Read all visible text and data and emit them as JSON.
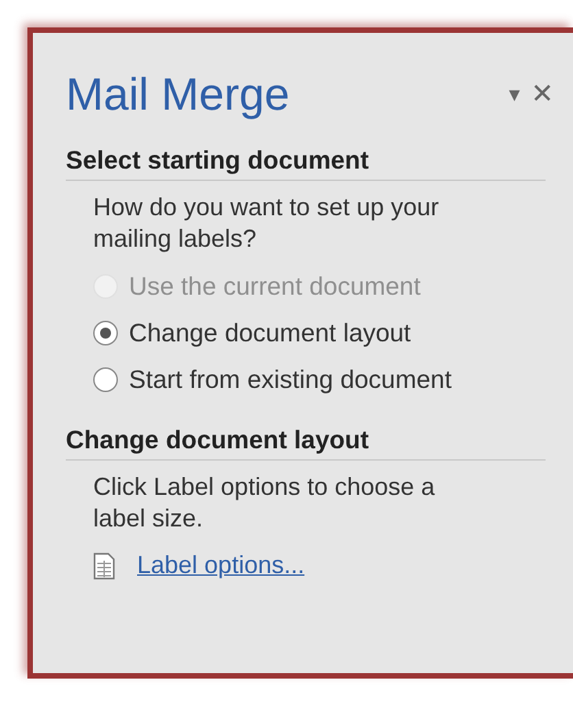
{
  "pane": {
    "title": "Mail Merge",
    "menu_glyph": "▾",
    "close_glyph": "✕"
  },
  "sections": [
    {
      "heading": "Select starting document",
      "text": "How do you want to set up your mailing labels?",
      "options": [
        {
          "label": "Use the current document",
          "selected": false,
          "disabled": true
        },
        {
          "label": "Change document layout",
          "selected": true,
          "disabled": false
        },
        {
          "label": "Start from existing document",
          "selected": false,
          "disabled": false
        }
      ]
    },
    {
      "heading": "Change document layout",
      "text": "Click Label options to choose a label size.",
      "link": "Label options..."
    }
  ]
}
